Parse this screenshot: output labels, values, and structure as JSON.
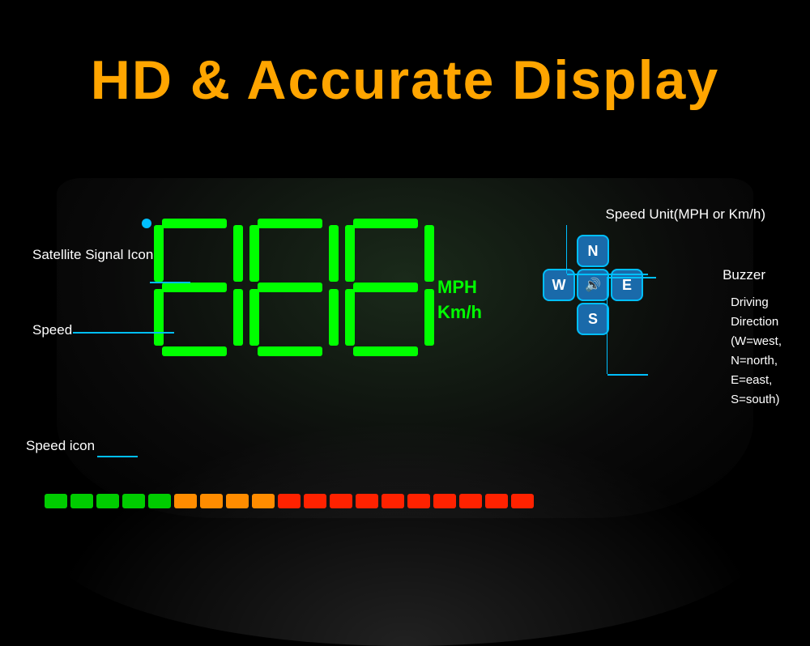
{
  "title": "HD & Accurate Display",
  "display": {
    "digits": "888",
    "mph_label": "MPH",
    "kmh_label": "Km/h"
  },
  "annotations": {
    "satellite_signal": "Satellite Signal Icon",
    "speed": "Speed",
    "speed_icon": "Speed icon",
    "speed_unit": "Speed Unit(MPH or Km/h)",
    "buzzer": "Buzzer",
    "driving_direction": "Driving Direction\n(W=west,\nN=north,\nE=east,\nS=south)"
  },
  "compass": {
    "north": "N",
    "west": "W",
    "east": "E",
    "south": "S",
    "buzzer_icon": "🔊"
  },
  "speed_bar": {
    "green_count": 5,
    "orange_count": 4,
    "red_count": 10,
    "colors": {
      "green": "#00CC00",
      "orange": "#FF8C00",
      "red": "#FF2200"
    }
  },
  "colors": {
    "title": "#FFA500",
    "digit": "#00FF00",
    "annotation_line": "#00BFFF",
    "annotation_text": "#FFFFFF",
    "compass_border": "#00BFFF",
    "compass_bg": "#1a6aaa"
  }
}
